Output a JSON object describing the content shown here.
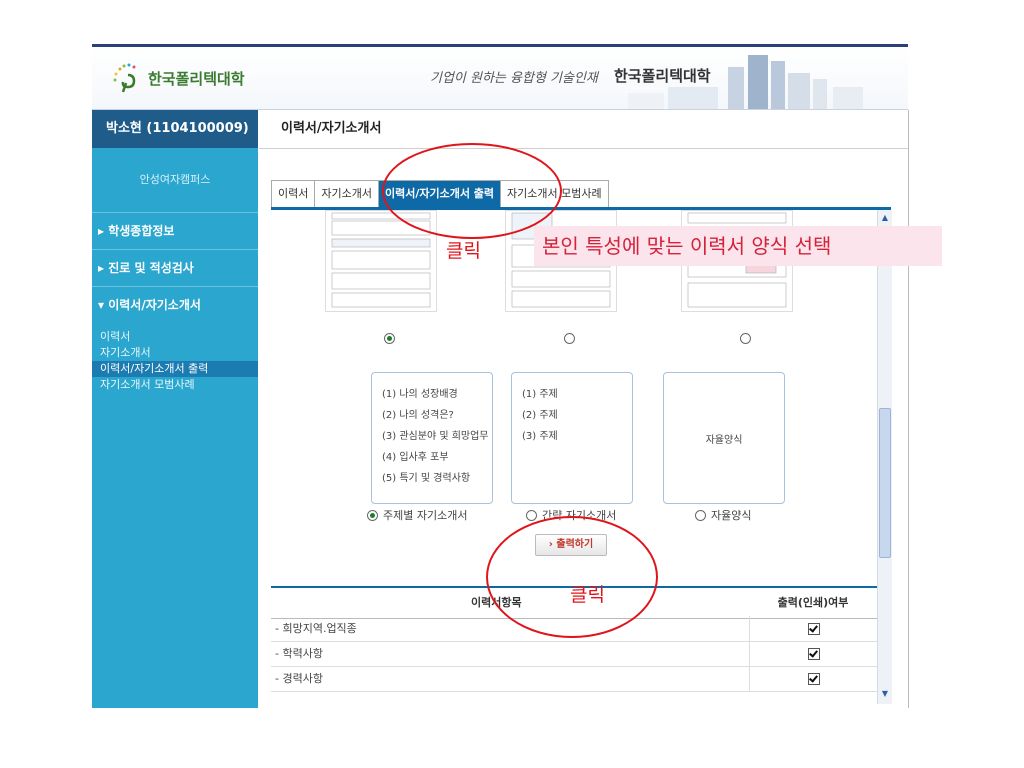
{
  "header": {
    "logo_text": "한국폴리텍대학",
    "slogan": "기업이 원하는 융합형 기술인재",
    "slogan_brand": "한국폴리텍대학"
  },
  "sidebar": {
    "user": "박소현 (1104100009)",
    "campus": "안성여자캠퍼스",
    "menus": [
      {
        "label": "▸ 학생종합정보"
      },
      {
        "label": "▸ 진로 및 적성검사"
      },
      {
        "label": "▾ 이력서/자기소개서"
      }
    ],
    "sub_items": [
      "이력서",
      "자기소개서",
      "이력서/자기소개서 출력",
      "자기소개서 모범사례"
    ],
    "active_sub": 2
  },
  "main": {
    "title": "이력서/자기소개서",
    "tabs": [
      "이력서",
      "자기소개서",
      "이력서/자기소개서 출력",
      "자기소개서 모범사례"
    ],
    "active_tab": 2,
    "resume_radio_selected": 0,
    "cards": [
      {
        "lines": [
          "(1) 나의 성장배경",
          "(2) 나의 성격은?",
          "(3) 관심분야 및 희망업무",
          "(4) 입사후 포부",
          "(5) 특기 및 경력사항"
        ],
        "label": "주제별 자기소개서",
        "selected": true
      },
      {
        "lines": [
          "(1) 주제",
          "(2) 주제",
          "(3) 주제"
        ],
        "label": "간략 자기소개서",
        "selected": false
      },
      {
        "lines": [
          "자율양식"
        ],
        "label": "자율양식",
        "selected": false
      }
    ],
    "print_button": "› 출력하기",
    "table": {
      "headers": [
        "이력서항목",
        "출력(인쇄)여부"
      ],
      "rows": [
        {
          "item": "- 희망지역.업직종",
          "checked": true
        },
        {
          "item": "- 학력사항",
          "checked": true
        },
        {
          "item": "- 경력사항",
          "checked": true
        }
      ]
    }
  },
  "annotations": {
    "click_top": "클릭",
    "click_bottom": "클릭",
    "instruction": "본인 특성에 맞는 이력서 양식 선택",
    "color": "#e0151b"
  }
}
